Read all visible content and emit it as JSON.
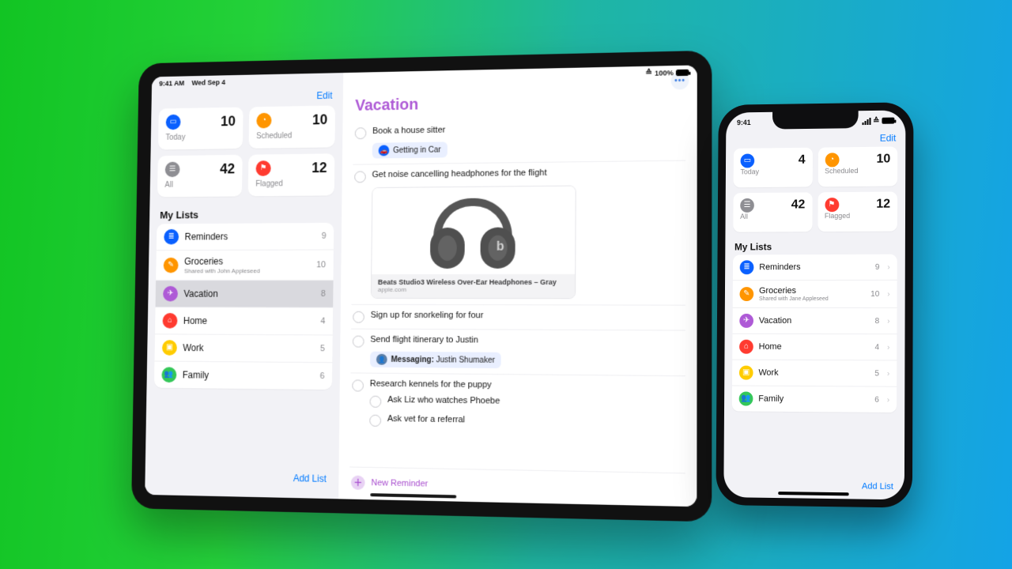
{
  "colors": {
    "blue": "#0a60ff",
    "orange": "#ff9500",
    "gray": "#8e8e93",
    "redflag": "#ff3b30",
    "purple": "#ae5ad6",
    "red": "#ff3b30",
    "yellow": "#ffcc00",
    "green": "#34c759",
    "link": "#007aff"
  },
  "ipad": {
    "status": {
      "time": "9:41 AM",
      "date": "Wed Sep 4",
      "battery": "100%"
    },
    "edit": "Edit",
    "smart": [
      {
        "key": "today",
        "label": "Today",
        "count": 10,
        "color": "blue",
        "icon": "calendar"
      },
      {
        "key": "scheduled",
        "label": "Scheduled",
        "count": 10,
        "color": "orange",
        "icon": "clock"
      },
      {
        "key": "all",
        "label": "All",
        "count": 42,
        "color": "gray",
        "icon": "inbox"
      },
      {
        "key": "flagged",
        "label": "Flagged",
        "count": 12,
        "color": "redflag",
        "icon": "flag"
      }
    ],
    "my_lists_title": "My Lists",
    "lists": [
      {
        "label": "Reminders",
        "sub": "",
        "count": 9,
        "color": "blue",
        "icon": "list",
        "selected": false
      },
      {
        "label": "Groceries",
        "sub": "Shared with John Appleseed",
        "count": 10,
        "color": "orange",
        "icon": "pencil",
        "selected": false
      },
      {
        "label": "Vacation",
        "sub": "",
        "count": 8,
        "color": "purple",
        "icon": "plane",
        "selected": true
      },
      {
        "label": "Home",
        "sub": "",
        "count": 4,
        "color": "red",
        "icon": "home",
        "selected": false
      },
      {
        "label": "Work",
        "sub": "",
        "count": 5,
        "color": "yellow",
        "icon": "brief",
        "selected": false
      },
      {
        "label": "Family",
        "sub": "",
        "count": 6,
        "color": "green",
        "icon": "people",
        "selected": false
      }
    ],
    "add_list": "Add List",
    "main": {
      "more": "•••",
      "title": "Vacation",
      "title_color": "purple",
      "items": [
        {
          "title": "Book a house sitter",
          "chip": {
            "icon": "car",
            "text": "Getting in Car"
          }
        },
        {
          "title": "Get noise cancelling headphones for the flight",
          "link": {
            "title": "Beats Studio3 Wireless Over-Ear Headphones – Gray",
            "source": "apple.com"
          }
        },
        {
          "title": "Sign up for snorkeling for four"
        },
        {
          "title": "Send flight itinerary to Justin",
          "chip": {
            "icon": "avatar",
            "text_prefix": "Messaging:",
            "text": "Justin Shumaker"
          }
        },
        {
          "title": "Research kennels for the puppy",
          "subs": [
            "Ask Liz who watches Phoebe",
            "Ask vet for a referral"
          ]
        }
      ],
      "new_reminder": "New Reminder"
    }
  },
  "iphone": {
    "status": {
      "time": "9:41"
    },
    "edit": "Edit",
    "smart": [
      {
        "key": "today",
        "label": "Today",
        "count": 4,
        "color": "blue",
        "icon": "calendar"
      },
      {
        "key": "scheduled",
        "label": "Scheduled",
        "count": 10,
        "color": "orange",
        "icon": "clock"
      },
      {
        "key": "all",
        "label": "All",
        "count": 42,
        "color": "gray",
        "icon": "inbox"
      },
      {
        "key": "flagged",
        "label": "Flagged",
        "count": 12,
        "color": "redflag",
        "icon": "flag"
      }
    ],
    "my_lists_title": "My Lists",
    "lists": [
      {
        "label": "Reminders",
        "sub": "",
        "count": 9,
        "color": "blue",
        "icon": "list"
      },
      {
        "label": "Groceries",
        "sub": "Shared with Jane Appleseed",
        "count": 10,
        "color": "orange",
        "icon": "pencil"
      },
      {
        "label": "Vacation",
        "sub": "",
        "count": 8,
        "color": "purple",
        "icon": "plane"
      },
      {
        "label": "Home",
        "sub": "",
        "count": 4,
        "color": "red",
        "icon": "home"
      },
      {
        "label": "Work",
        "sub": "",
        "count": 5,
        "color": "yellow",
        "icon": "brief"
      },
      {
        "label": "Family",
        "sub": "",
        "count": 6,
        "color": "green",
        "icon": "people"
      }
    ],
    "add_list": "Add List"
  },
  "icons": {
    "calendar": "▭",
    "clock": "◔",
    "inbox": "☰",
    "flag": "⚑",
    "list": "≣",
    "pencil": "✎",
    "plane": "✈",
    "home": "⌂",
    "brief": "▣",
    "people": "👥",
    "car": "🚗",
    "avatar": "👤"
  }
}
